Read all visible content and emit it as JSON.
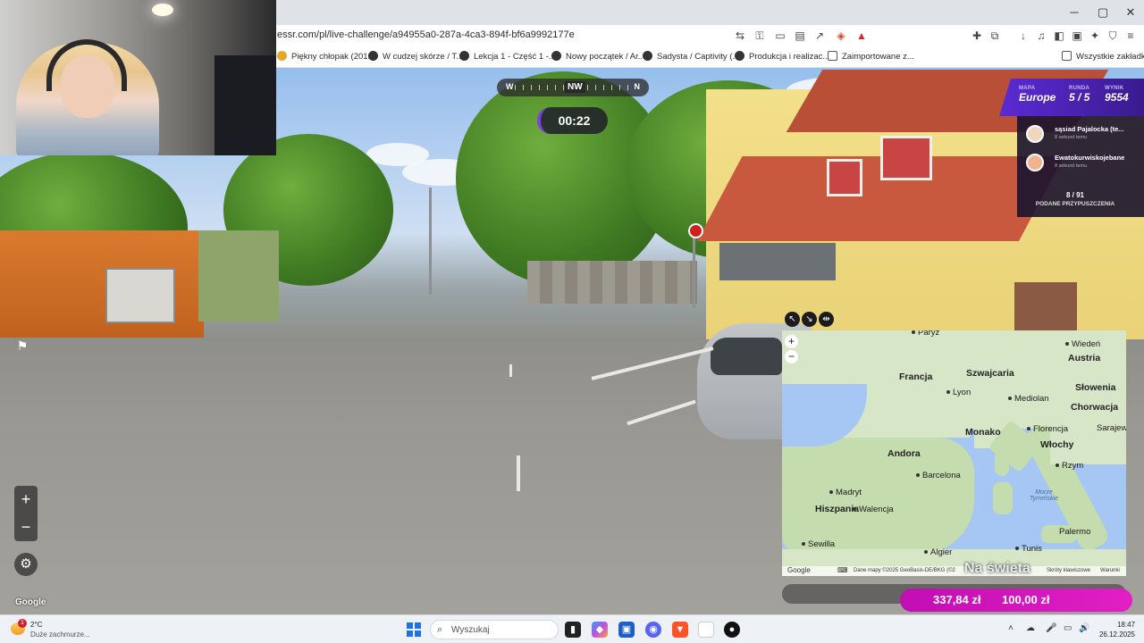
{
  "browser": {
    "url_visible": "essr.com/pl/live-challenge/a94955a0-287a-4ca3-894f-bf6a9992177e",
    "bookmarks": [
      "Piękny chłopak (201...",
      "W cudzej skórze / T...",
      "Lekcja 1 - Część 1 -...",
      "Nowy początek / Ar...",
      "Sadysta / Captivity (...",
      "Produkcja i realizac...",
      "Zaimportowane z..."
    ],
    "bookmarks_folder": "Wszystkie zakładki",
    "window_controls": [
      "─",
      "▢",
      "✕"
    ]
  },
  "hud": {
    "compass": {
      "left": "W",
      "center": "NW",
      "right": "N"
    },
    "timer": "00:22",
    "score": {
      "map_label": "MAPA",
      "map_value": "Europe",
      "round_label": "RUNDA",
      "round_value": "5 / 5",
      "score_label": "WYNIK",
      "score_value": "9554"
    },
    "players": [
      {
        "name": "sąsiad Pajalocka (te...",
        "time": "8 sekund temu"
      },
      {
        "name": "Ewatokurwiskojebane",
        "time": "8 sekund temu"
      }
    ],
    "guess_count": "8 / 91",
    "guess_label": "PODANE PRZYPUSZCZENIA",
    "controls": {
      "zoom_in": "+",
      "zoom_out": "−",
      "settings": "⚙",
      "report": "⚑"
    },
    "google_mark": "Google"
  },
  "map": {
    "countries": [
      "Francja",
      "Szwajcaria",
      "Austria",
      "Słowenia",
      "Chorwacja",
      "Andora",
      "Monako",
      "Włochy",
      "Hiszpania"
    ],
    "cities": [
      "Paryż",
      "Wiedeń",
      "Lyon",
      "Mediolan",
      "Florencja",
      "Sarajewo",
      "Barcelona",
      "Rzym",
      "Madryt",
      "Walencja",
      "Sewilla",
      "Algier",
      "Tunis",
      "Palermo"
    ],
    "sea": "Morze Tyrreńskie",
    "footer": {
      "google": "Google",
      "keyboard": "⌨",
      "data": "Dane mapy ©2025 GeoBasis-DE/BKG (©2",
      "shortcuts": "Skróty klawiszowe",
      "terms": "Warunki"
    },
    "tools": [
      "↖",
      "↘",
      "⇹"
    ],
    "zoom_in": "+",
    "zoom_out": "−"
  },
  "stream_overlay": {
    "label": "Na świeta",
    "amount_raised": "337,84 zł",
    "amount_goal": "100,00 zł"
  },
  "taskbar": {
    "weather_temp": "2°C",
    "weather_desc": "Duże zachmurze...",
    "weather_badge": "1",
    "search_placeholder": "Wyszukaj",
    "time": "18:47",
    "date": "26.12.2025"
  },
  "colors": {
    "accent_purple": "#5b2bd4",
    "donation_pink": "#d41bbd",
    "map_water": "#a6c7f3"
  }
}
